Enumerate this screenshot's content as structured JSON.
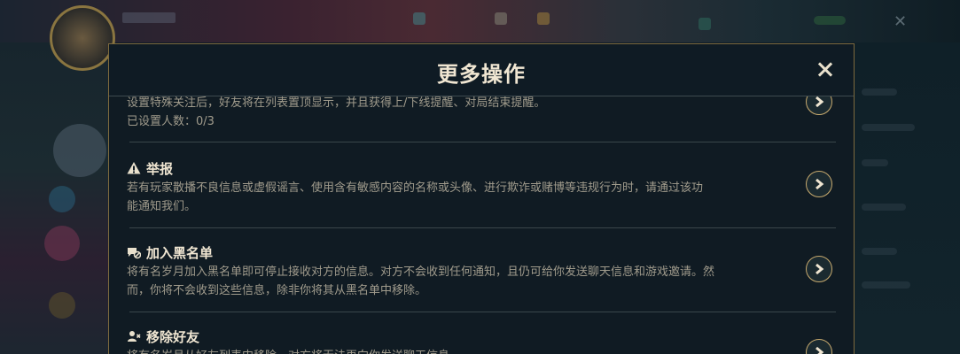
{
  "modal": {
    "title": "更多操作"
  },
  "sections": [
    {
      "id": "special-follow",
      "title": "",
      "desc_line1": "设置特殊关注后，好友将在列表置顶显示，并且获得上/下线提醒、对局结束提醒。",
      "desc_line2": "已设置人数：0/3"
    },
    {
      "id": "report",
      "icon": "warning-icon",
      "title": "举报",
      "desc_line1": "若有玩家散播不良信息或虚假谣言、使用含有敏感内容的名称或头像、进行欺诈或赌博等违规行为时，请通过该功",
      "desc_line2": "能通知我们。"
    },
    {
      "id": "blacklist",
      "icon": "block-chat-icon",
      "title": "加入黑名单",
      "desc_line1": "将有名岁月加入黑名单即可停止接收对方的信息。对方不会收到任何通知，且仍可给你发送聊天信息和游戏邀请。然",
      "desc_line2": "而，你将不会收到这些信息，除非你将其从黑名单中移除。"
    },
    {
      "id": "remove-friend",
      "icon": "remove-user-icon",
      "title": "移除好友",
      "desc_line1": "将有名岁月从好友列表中移除，对方将无法再向你发送聊天信息。"
    }
  ],
  "colors": {
    "gold": "#c8aa6e",
    "title_text": "#f0e6d2",
    "desc_text": "#a09b8c",
    "modal_bg": "#101b23"
  }
}
